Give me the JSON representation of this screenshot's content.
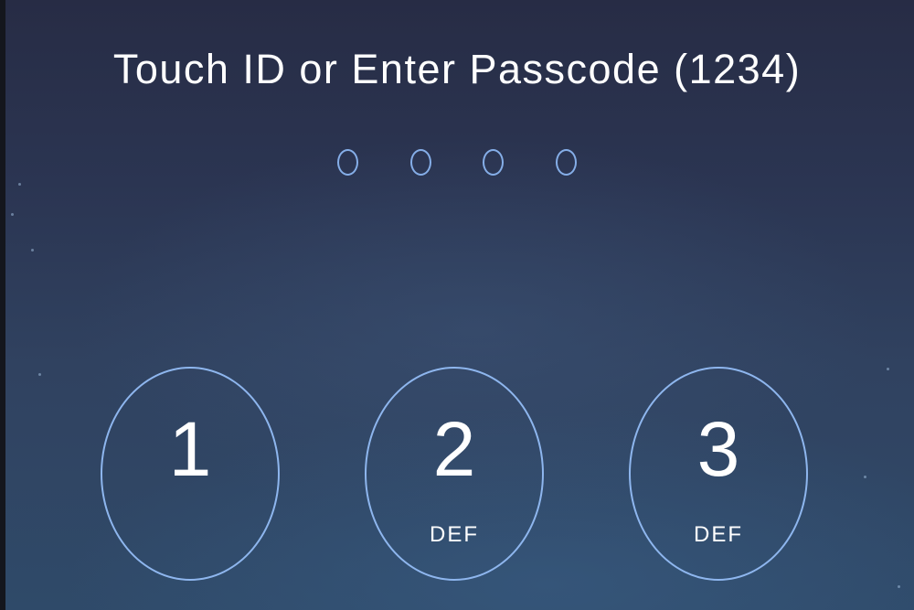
{
  "lock_screen": {
    "title": "Touch ID or Enter Passcode (1234)",
    "passcode_dots": [
      {
        "filled": false
      },
      {
        "filled": false
      },
      {
        "filled": false
      },
      {
        "filled": false
      }
    ],
    "keypad": [
      {
        "digit": "1",
        "letters": ""
      },
      {
        "digit": "2",
        "letters": "DEF"
      },
      {
        "digit": "3",
        "letters": "DEF"
      }
    ]
  },
  "colors": {
    "ring": "#8eb6ee",
    "dot_ring": "#85aee8",
    "text": "#ffffff",
    "background_top": "#272c45",
    "background_bottom": "#2f4a69"
  }
}
